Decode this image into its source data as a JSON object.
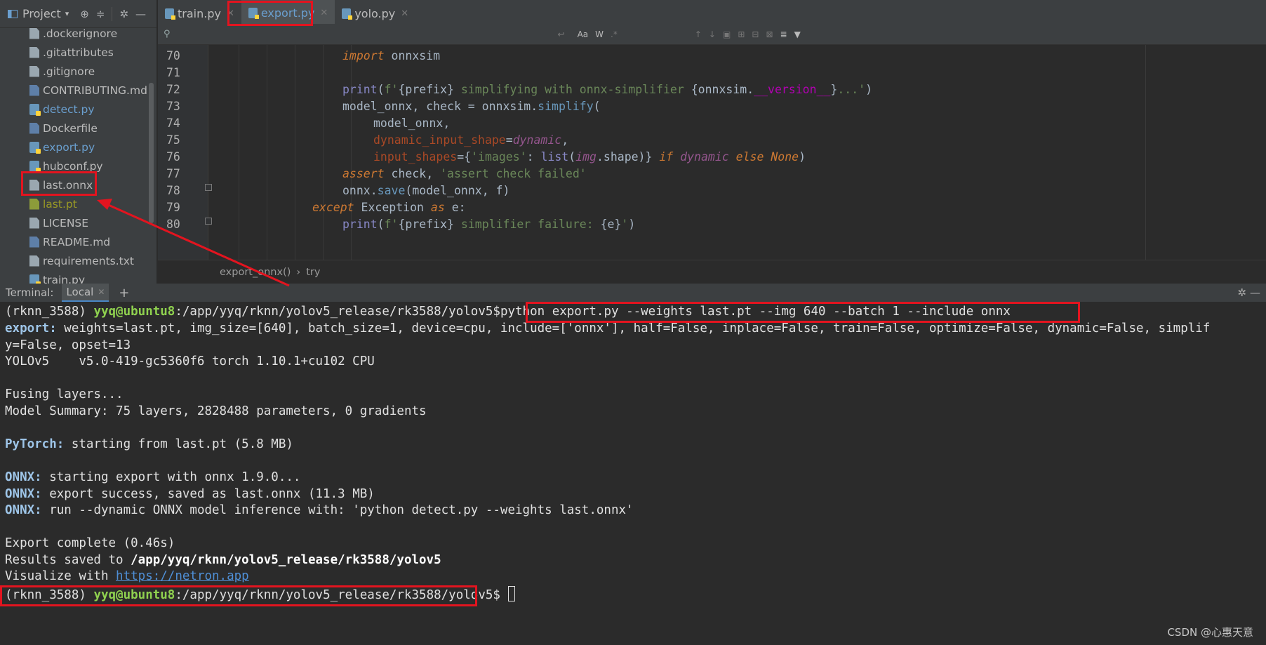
{
  "project_panel": {
    "title": "Project",
    "files": [
      {
        "name": ".dockerignore",
        "icon": "doc",
        "color": "normal"
      },
      {
        "name": ".gitattributes",
        "icon": "doc",
        "color": "normal"
      },
      {
        "name": ".gitignore",
        "icon": "doc",
        "color": "normal"
      },
      {
        "name": "CONTRIBUTING.md",
        "icon": "md",
        "color": "normal"
      },
      {
        "name": "detect.py",
        "icon": "py",
        "color": "blue"
      },
      {
        "name": "Dockerfile",
        "icon": "md",
        "color": "normal"
      },
      {
        "name": "export.py",
        "icon": "py",
        "color": "blue"
      },
      {
        "name": "hubconf.py",
        "icon": "py",
        "color": "normal"
      },
      {
        "name": "last.onnx",
        "icon": "doc",
        "color": "normal"
      },
      {
        "name": "last.pt",
        "icon": "pt",
        "color": "olive"
      },
      {
        "name": "LICENSE",
        "icon": "doc",
        "color": "normal"
      },
      {
        "name": "README.md",
        "icon": "md",
        "color": "normal"
      },
      {
        "name": "requirements.txt",
        "icon": "doc",
        "color": "normal"
      },
      {
        "name": "train.py",
        "icon": "py",
        "color": "normal"
      }
    ]
  },
  "editor": {
    "tabs": [
      {
        "label": "train.py",
        "active": false
      },
      {
        "label": "export.py",
        "active": true
      },
      {
        "label": "yolo.py",
        "active": false
      }
    ],
    "line_numbers": [
      "70",
      "71",
      "72",
      "73",
      "74",
      "75",
      "76",
      "77",
      "78",
      "79",
      "80"
    ],
    "breadcrumb": [
      "export_onnx()",
      "try"
    ]
  },
  "terminal": {
    "title": "Terminal:",
    "tab_label": "Local",
    "prompt_env": "(rknn_3588)",
    "prompt_user": "yyq@ubuntu8",
    "prompt_path": ":/app/yyq/rknn/yolov5_release/rk3588/yolov5$",
    "command": "python export.py --weights last.pt --img 640 --batch 1 --include onnx",
    "export_tag": "export:",
    "export_args_1": " weights=last.pt, img_size=[640], batch_size=1, device=cpu, include=['onnx'], half=False, inplace=False, train=False, optimize=False, dynamic=False, simplif",
    "export_args_2": "y=False, opset=13",
    "yolo_version": "YOLOv5    v5.0-419-gc5360f6 torch 1.10.1+cu102 CPU",
    "fusing": "Fusing layers...",
    "model_summary": "Model Summary: 75 layers, 2828488 parameters, 0 gradients",
    "pytorch_tag": "PyTorch:",
    "pytorch_msg": " starting from last.pt (5.8 MB)",
    "onnx_tag": "ONNX:",
    "onnx_msg_1": " starting export with onnx 1.9.0...",
    "onnx_msg_2": " export success, saved as last.onnx (11.3 MB)",
    "onnx_msg_3": " run --dynamic ONNX model inference with: 'python detect.py --weights last.onnx'",
    "export_complete": "Export complete (0.46s)",
    "results_prefix": "Results saved to ",
    "results_path": "/app/yyq/rknn/yolov5_release/rk3588/yolov5",
    "visualize_prefix": "Visualize with ",
    "visualize_link": "https://netron.app"
  },
  "watermark": "CSDN @心惠天意",
  "colors": {
    "annotation_red": "#e3141f",
    "ide_background": "#2b2b2b",
    "panel_background": "#3c3f41",
    "prompt_green": "#8fd14f",
    "link_blue": "#4f8fd6"
  }
}
